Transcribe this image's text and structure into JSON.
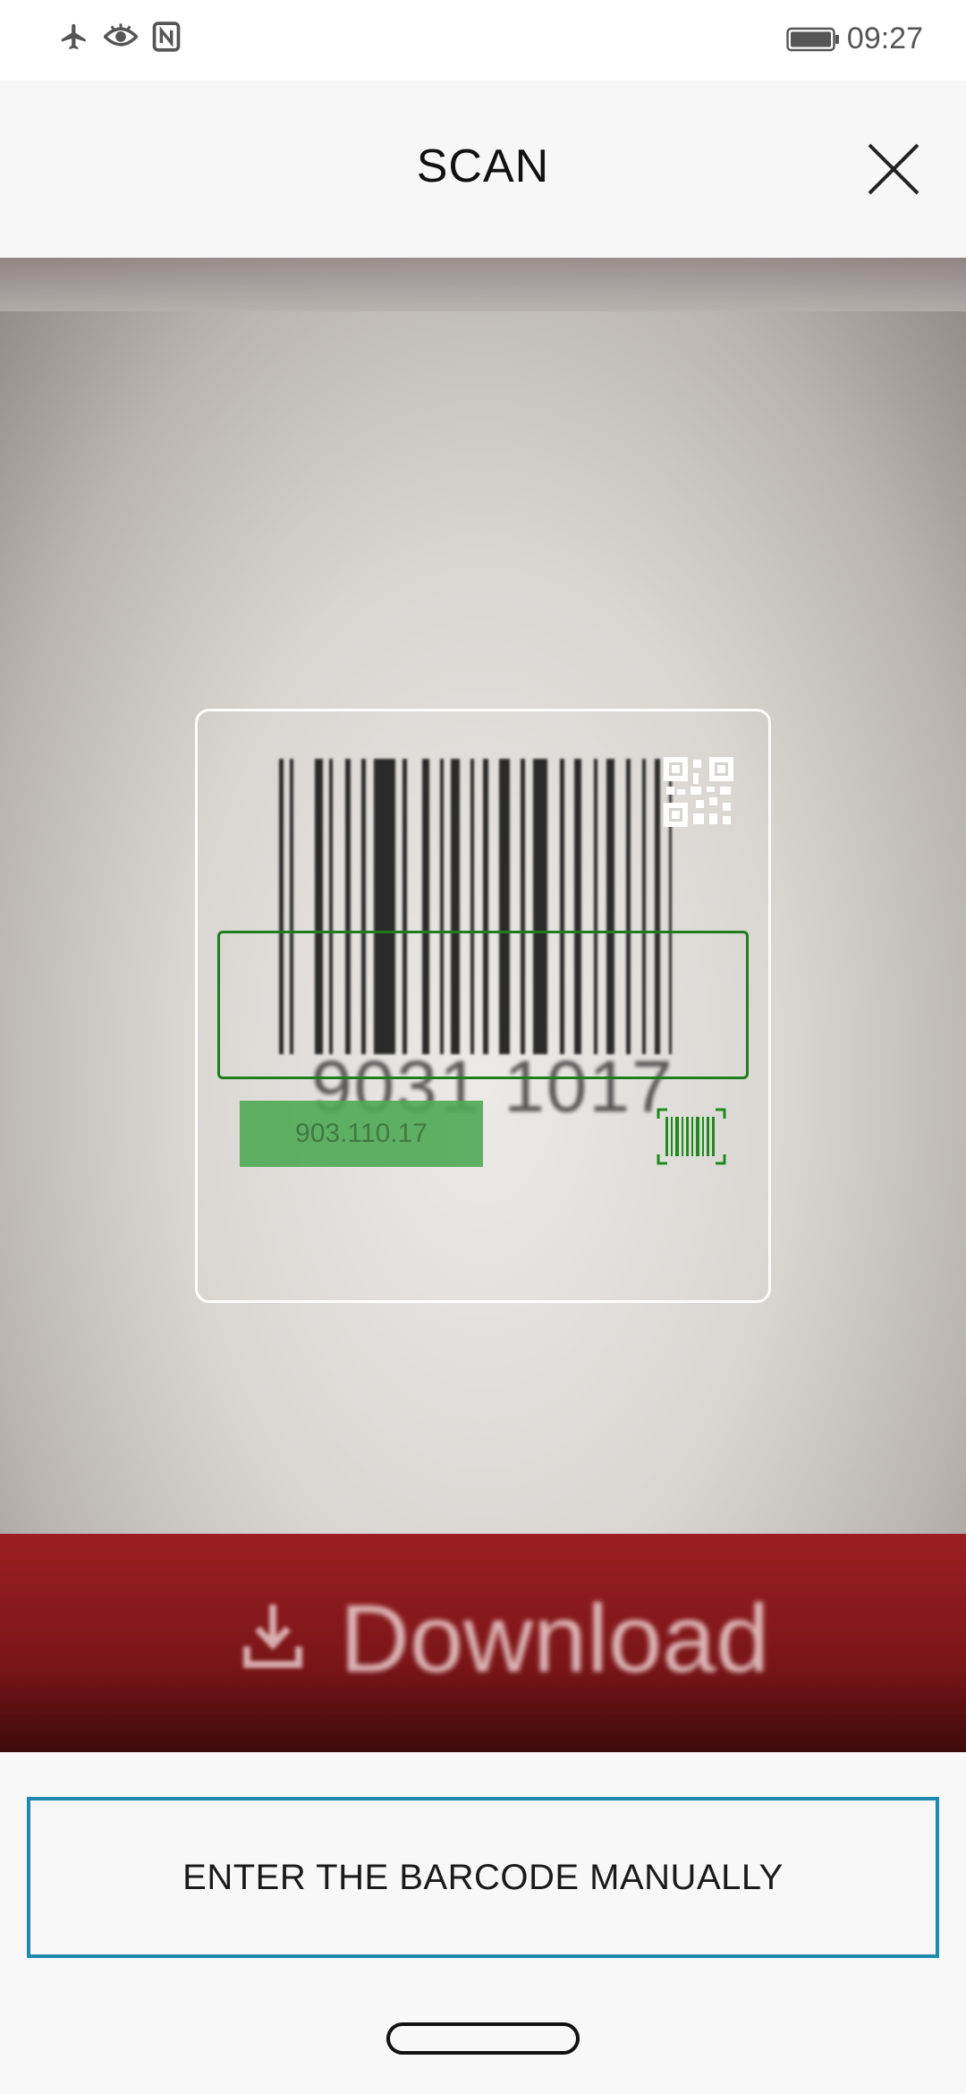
{
  "status_bar": {
    "icons": [
      "airplane-icon",
      "eye-icon",
      "nfc-icon"
    ],
    "battery_icon": "battery-icon",
    "time": "09:27"
  },
  "header": {
    "title": "SCAN",
    "close_icon": "close-icon"
  },
  "camera": {
    "background_text": "Download",
    "barcode_digits": "9031  1017",
    "detected_value": "903.110.17",
    "qr_mode_icon": "qr-code-icon",
    "barcode_mode_icon": "barcode-icon",
    "accent_color": "#1e7d1e"
  },
  "footer": {
    "manual_button_label": "ENTER THE BARCODE MANUALLY",
    "button_border_color": "#1f8ab0"
  }
}
